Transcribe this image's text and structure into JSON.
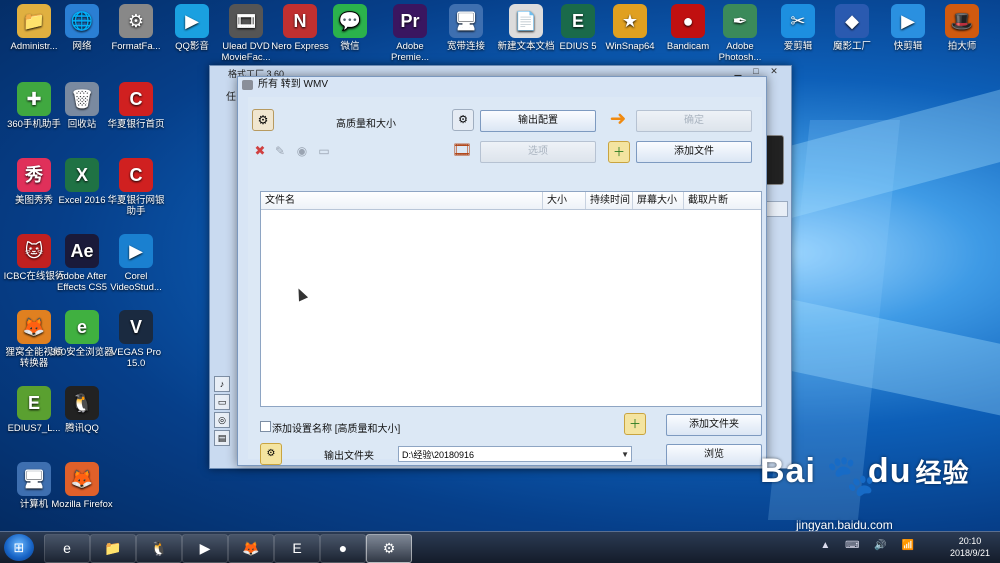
{
  "desktop": {
    "icons": [
      {
        "label": "Administr...",
        "glyph": "📁",
        "color": "#e0b040"
      },
      {
        "label": "网络",
        "glyph": "🌐",
        "color": "#2a7fd4"
      },
      {
        "label": "FormatFa...",
        "glyph": "⚙",
        "color": "#888"
      },
      {
        "label": "QQ影音",
        "glyph": "▶",
        "color": "#1aa0e0"
      },
      {
        "label": "Ulead DVD MovieFac...",
        "glyph": "🎞",
        "color": "#555"
      },
      {
        "label": "Nero Express",
        "glyph": "N",
        "color": "#c03030"
      },
      {
        "label": "微信",
        "glyph": "💬",
        "color": "#2bb24c"
      },
      {
        "label": "Adobe Premie...",
        "glyph": "Pr",
        "color": "#3a1660"
      },
      {
        "label": "宽带连接",
        "glyph": "🖥",
        "color": "#3e6fb0"
      },
      {
        "label": "新建文本文档",
        "glyph": "📄",
        "color": "#dcdcdc"
      },
      {
        "label": "EDIUS 5",
        "glyph": "E",
        "color": "#1a6a4a"
      },
      {
        "label": "WinSnap64",
        "glyph": "★",
        "color": "#e0a020"
      },
      {
        "label": "Bandicam",
        "glyph": "●",
        "color": "#c01010"
      },
      {
        "label": "Adobe Photosh...",
        "glyph": "✒",
        "color": "#3b8a5a"
      },
      {
        "label": "爱剪辑",
        "glyph": "✂",
        "color": "#1d8fe0"
      },
      {
        "label": "魔影工厂",
        "glyph": "◆",
        "color": "#2a5ab0"
      },
      {
        "label": "快剪辑",
        "glyph": "▶",
        "color": "#2a90e0"
      },
      {
        "label": "拍大师",
        "glyph": "🎩",
        "color": "#d05a10"
      },
      {
        "label": "360手机助手",
        "glyph": "✚",
        "color": "#40a840"
      },
      {
        "label": "回收站",
        "glyph": "🗑",
        "color": "#7a8aa0"
      },
      {
        "label": "华夏银行首页",
        "glyph": "C",
        "color": "#d02020"
      },
      {
        "label": "美图秀秀",
        "glyph": "秀",
        "color": "#e0305a"
      },
      {
        "label": "Excel 2016",
        "glyph": "X",
        "color": "#1f7244"
      },
      {
        "label": "华夏银行网银助手",
        "glyph": "C",
        "color": "#d02020"
      },
      {
        "label": "ICBC在线银行",
        "glyph": "🐱",
        "color": "#c02020"
      },
      {
        "label": "Adobe After Effects CS5",
        "glyph": "Ae",
        "color": "#1a1a3a"
      },
      {
        "label": "Corel VideoStud...",
        "glyph": "▶",
        "color": "#1a80d0"
      },
      {
        "label": "狸窝全能视频转换器",
        "glyph": "🦊",
        "color": "#e08020"
      },
      {
        "label": "360安全浏览器",
        "glyph": "e",
        "color": "#40b040"
      },
      {
        "label": "VEGAS Pro 15.0",
        "glyph": "V",
        "color": "#1a2a40"
      },
      {
        "label": "EDIUS7_L...",
        "glyph": "E",
        "color": "#5aa030"
      },
      {
        "label": "腾讯QQ",
        "glyph": "🐧",
        "color": "#222"
      },
      {
        "label": "计算机",
        "glyph": "🖥",
        "color": "#3e6fb0"
      },
      {
        "label": "Mozilla Firefox",
        "glyph": "🦊",
        "color": "#e0602a"
      }
    ]
  },
  "bg_window": {
    "title": "格式工厂 3.60",
    "menu_fragment": "任",
    "controls": [
      "▁",
      "□",
      "✕"
    ]
  },
  "dialog": {
    "title": "所有 转到 WMV",
    "preset_label": "高质量和大小",
    "output_config_button": "输出配置",
    "confirm_button": "确定",
    "options_button": "选项",
    "add_file_button": "添加文件",
    "columns": [
      "文件名",
      "大小",
      "持续时间",
      "屏幕大小",
      "截取片断"
    ],
    "add_setting_name_checkbox": "添加设置名称",
    "add_setting_name_value": "[高质量和大小]",
    "add_folder_button": "添加文件夹",
    "output_folder_label": "输出文件夹",
    "output_folder_value": "D:\\经验\\20180916",
    "browse_button": "浏览"
  },
  "taskbar": {
    "start_glyph": "⊞",
    "items": [
      {
        "name": "360browser",
        "glyph": "e"
      },
      {
        "name": "explorer",
        "glyph": "📁"
      },
      {
        "name": "qq",
        "glyph": "🐧"
      },
      {
        "name": "qqplayer",
        "glyph": "▶"
      },
      {
        "name": "firefox",
        "glyph": "🦊"
      },
      {
        "name": "edius",
        "glyph": "E"
      },
      {
        "name": "bandicam",
        "glyph": "●"
      },
      {
        "name": "formatfactory",
        "glyph": "⚙"
      }
    ],
    "time": "20:10",
    "date": "2018/9/21"
  },
  "watermark": {
    "brand": "Bai",
    "brand2": "du",
    "brand3": "经验",
    "url": "jingyan.baidu.com"
  },
  "colors": {
    "accent": "#1662c4",
    "dialog_bg": "#d8e5f5",
    "button_border": "#7d9ac0"
  }
}
